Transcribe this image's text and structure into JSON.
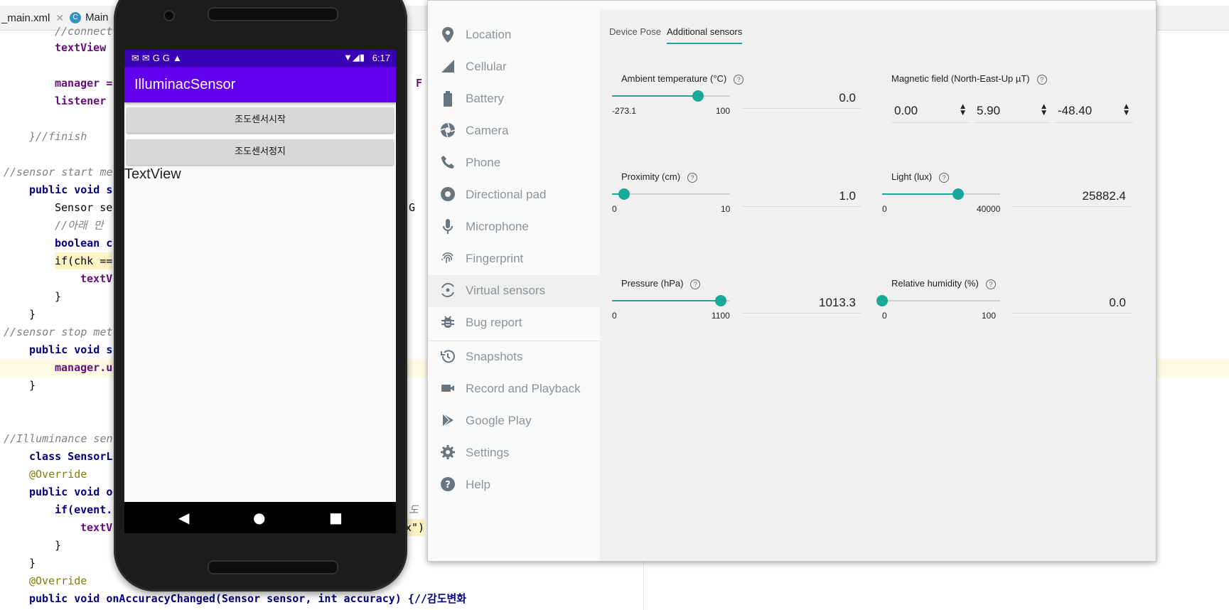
{
  "ide": {
    "tabs": [
      {
        "label": "_main.xml"
      },
      {
        "label": "Main"
      }
    ],
    "code_lines": [
      {
        "text": "//connect"
      },
      {
        "text": "textView"
      },
      {
        "text": "manager ="
      },
      {
        "text": "listener"
      },
      {
        "text": "}//finish"
      },
      {
        "text": "//sensor start me"
      },
      {
        "text": "public void s"
      },
      {
        "text": "Sensor se"
      },
      {
        "text": "//아래 만"
      },
      {
        "text": "boolean c"
      },
      {
        "text": "if(chk =="
      },
      {
        "text": "textV"
      },
      {
        "text": "}"
      },
      {
        "text": "}"
      },
      {
        "text": "//sensor stop met"
      },
      {
        "text": "public void s"
      },
      {
        "text": "manager.u"
      },
      {
        "text": "}"
      },
      {
        "text": "//Illuminance sen"
      },
      {
        "text": "class SensorL"
      },
      {
        "text": "@Override"
      },
      {
        "text": "public void o"
      },
      {
        "text": "if(event."
      },
      {
        "text": "textV"
      },
      {
        "text": "}"
      },
      {
        "text": "}"
      },
      {
        "text": "@Override"
      },
      {
        "text": "public void onAccuracyChanged(Sensor sensor, int accuracy) {//감도변화"
      }
    ],
    "peek_right": [
      {
        "text": "F"
      },
      {
        "text": "G"
      },
      {
        "text": "도"
      },
      {
        "text": "x\")"
      }
    ]
  },
  "phone": {
    "status_time": "6:17",
    "app_title": "IlluminacSensor",
    "buttons": [
      {
        "label": "조도센서시작"
      },
      {
        "label": "조도센서정지"
      }
    ],
    "text_view": "TextView"
  },
  "extended_controls": {
    "sidebar": [
      {
        "label": "Location",
        "icon": "location-pin-icon"
      },
      {
        "label": "Cellular",
        "icon": "cellular-signal-icon"
      },
      {
        "label": "Battery",
        "icon": "battery-icon"
      },
      {
        "label": "Camera",
        "icon": "camera-aperture-icon"
      },
      {
        "label": "Phone",
        "icon": "phone-handset-icon"
      },
      {
        "label": "Directional pad",
        "icon": "dpad-icon"
      },
      {
        "label": "Microphone",
        "icon": "microphone-icon"
      },
      {
        "label": "Fingerprint",
        "icon": "fingerprint-icon"
      },
      {
        "label": "Virtual sensors",
        "icon": "virtual-sensors-icon"
      },
      {
        "label": "Bug report",
        "icon": "bug-icon"
      },
      {
        "label": "Snapshots",
        "icon": "history-icon"
      },
      {
        "label": "Record and Playback",
        "icon": "video-camera-icon"
      },
      {
        "label": "Google Play",
        "icon": "google-play-icon"
      },
      {
        "label": "Settings",
        "icon": "gear-icon"
      },
      {
        "label": "Help",
        "icon": "help-icon"
      }
    ],
    "active_item": "Virtual sensors",
    "tabs": [
      {
        "label": "Device Pose"
      },
      {
        "label": "Additional sensors"
      }
    ],
    "active_tab": "Additional sensors",
    "accent_color": "#17a999",
    "sensors": {
      "ambient_temperature": {
        "label": "Ambient temperature (°C)",
        "min": "-273.1",
        "max": "100",
        "value": "0.0",
        "slider_fraction": 0.73
      },
      "magnetic_field": {
        "label": "Magnetic field (North-East-Up µT)",
        "values": [
          "0.00",
          "5.90",
          "-48.40"
        ]
      },
      "proximity": {
        "label": "Proximity (cm)",
        "min": "0",
        "max": "10",
        "value": "1.0",
        "slider_fraction": 0.1
      },
      "light": {
        "label": "Light (lux)",
        "min": "0",
        "max": "40000",
        "value": "25882.4",
        "slider_fraction": 0.647
      },
      "pressure": {
        "label": "Pressure (hPa)",
        "min": "0",
        "max": "1100",
        "value": "1013.3",
        "slider_fraction": 0.921
      },
      "relative_humidity": {
        "label": "Relative humidity (%)",
        "min": "0",
        "max": "100",
        "value": "0.0",
        "slider_fraction": 0.0
      }
    }
  }
}
